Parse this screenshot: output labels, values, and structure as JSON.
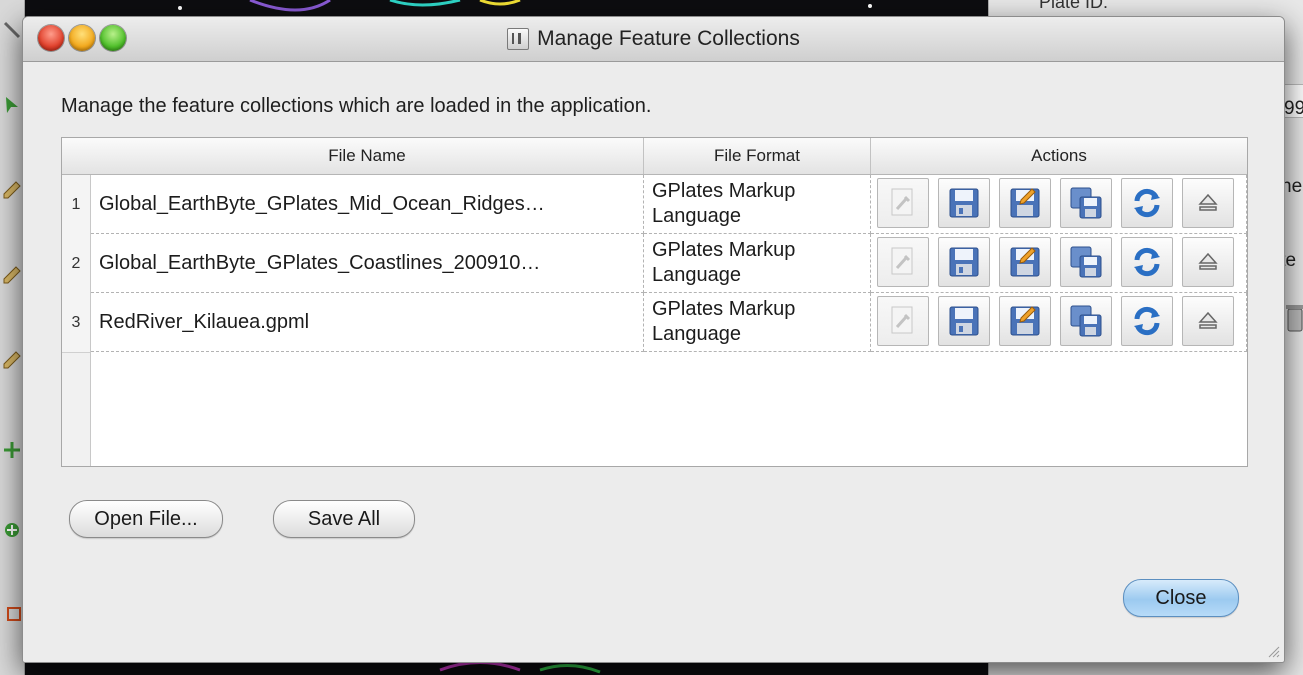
{
  "background": {
    "side_panel": {
      "plate_label": "Plate ID:",
      "peek_texts": [
        "99",
        "ne",
        "ite"
      ]
    }
  },
  "dialog": {
    "title": "Manage Feature Collections",
    "description": "Manage the feature collections which are loaded in the application.",
    "table": {
      "columns": [
        "File Name",
        "File Format",
        "Actions"
      ],
      "rows": [
        {
          "index": "1",
          "file_name": "Global_EarthByte_GPlates_Mid_Ocean_Ridges…",
          "format_line1": "GPlates Markup",
          "format_line2": "Language"
        },
        {
          "index": "2",
          "file_name": "Global_EarthByte_GPlates_Coastlines_200910…",
          "format_line1": "GPlates Markup",
          "format_line2": "Language"
        },
        {
          "index": "3",
          "file_name": "RedRiver_Kilauea.gpml",
          "format_line1": "GPlates Markup",
          "format_line2": "Language"
        }
      ],
      "actions": [
        {
          "icon": "edit-configuration-icon",
          "enabled": false
        },
        {
          "icon": "save-icon",
          "enabled": true
        },
        {
          "icon": "save-as-icon",
          "enabled": true
        },
        {
          "icon": "save-copy-icon",
          "enabled": true
        },
        {
          "icon": "reload-icon",
          "enabled": true
        },
        {
          "icon": "unload-eject-icon",
          "enabled": true
        }
      ]
    },
    "buttons": {
      "open_file": "Open File...",
      "save_all": "Save All",
      "close": "Close"
    }
  },
  "colors": {
    "close_button_blue": "#9ccaf0",
    "reload_blue": "#2a6fc4"
  }
}
